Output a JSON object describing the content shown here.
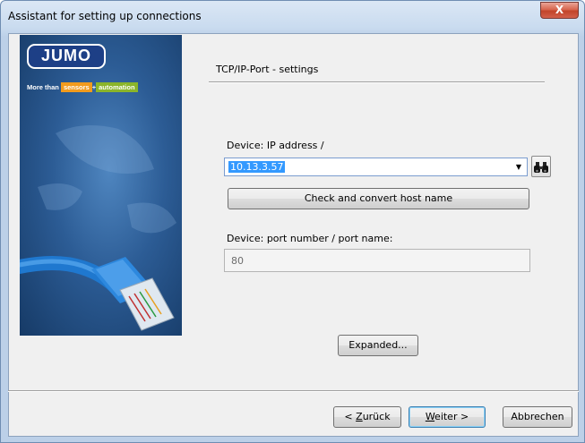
{
  "window": {
    "title": "Assistant for setting up connections",
    "close_label": "X"
  },
  "banner": {
    "logo": "JUMO",
    "tagline_prefix": "More than",
    "tagline_sensors": "sensors",
    "tagline_plus": "+",
    "tagline_automation": "automation"
  },
  "section": {
    "title": "TCP/IP-Port - settings"
  },
  "device_ip": {
    "label": "Device: IP address /",
    "value": "10.13.3.57"
  },
  "check_button": {
    "label": "Check and convert host name"
  },
  "device_port": {
    "label": "Device:  port number / port name:",
    "value": "80"
  },
  "expanded_button": {
    "label": "Expanded..."
  },
  "footer": {
    "back_prefix": "< ",
    "back_mnemonic": "Z",
    "back_rest": "urück",
    "next_mnemonic": "W",
    "next_rest": "eiter >",
    "cancel_label": "Abbrechen"
  }
}
